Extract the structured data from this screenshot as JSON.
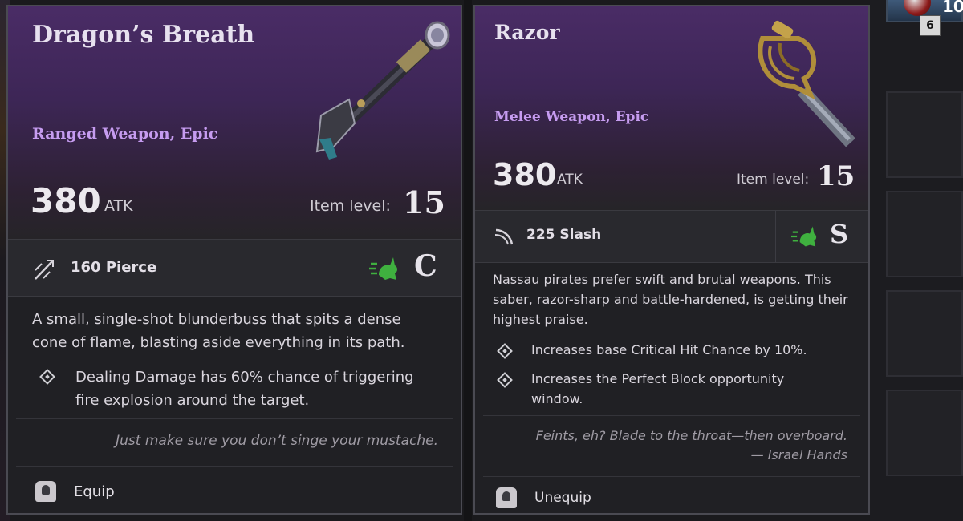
{
  "cards": [
    {
      "title": "Dragon’s Breath",
      "type": "Ranged Weapon, Epic",
      "atk_value": "380",
      "atk_label": "ATK",
      "item_level_label": "Item level:",
      "item_level": "15",
      "damage": "160 Pierce",
      "damage_icon": "pierce-icon",
      "speed_icon": "rabbit-speed-icon",
      "grade": "C",
      "description": "A small, single-shot blunderbuss that spits a dense cone of flame, blasting aside everything in its path.",
      "perks": [
        "Dealing Damage has 60% chance of triggering fire explosion around the target."
      ],
      "quote": "Just make sure you don’t singe your mustache.",
      "action": "Equip",
      "weapon_icon": "blunderbuss-icon"
    },
    {
      "title": "Razor",
      "type": "Melee Weapon, Epic",
      "atk_value": "380",
      "atk_label": "ATK",
      "item_level_label": "Item level:",
      "item_level": "15",
      "damage": "225 Slash",
      "damage_icon": "slash-icon",
      "speed_icon": "rabbit-speed-icon",
      "grade": "S",
      "description": "Nassau pirates prefer swift and brutal weapons. This saber, razor-sharp and battle-hardened, is getting their highest praise.",
      "perks": [
        "Increases base Critical Hit Chance by 10%.",
        "Increases the Perfect Block opportunity window."
      ],
      "quote_line1": "Feints, eh? Blade to the throat—then overboard.",
      "quote_line2": "— Israel Hands",
      "action": "Unequip",
      "weapon_icon": "saber-icon"
    }
  ],
  "inventory": {
    "top_count": "6",
    "top_number": "10"
  },
  "colors": {
    "header_purple": "#4a2c66",
    "rarity_text": "#c69cf0",
    "speed_green": "#3fb03f"
  }
}
